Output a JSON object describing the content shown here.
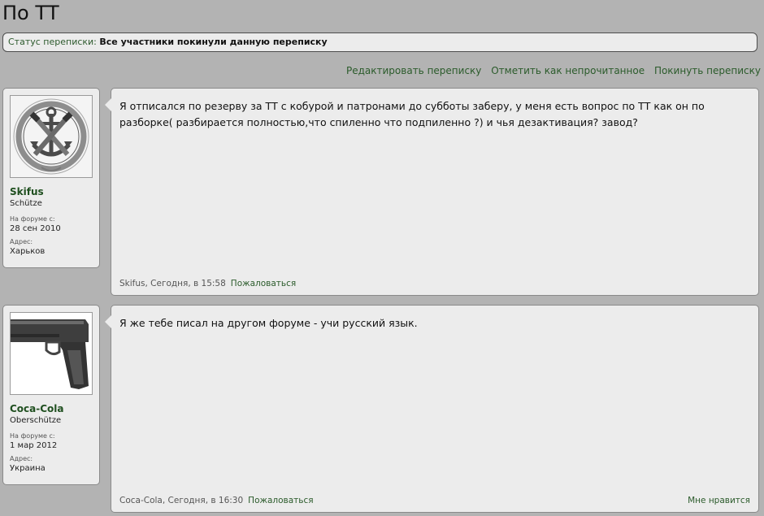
{
  "page": {
    "title": "По ТТ"
  },
  "status": {
    "label": "Статус переписки:",
    "value": "Все участники покинули данную переписку"
  },
  "actions": {
    "edit": "Редактировать переписку",
    "mark_unread": "Отметить как непрочитанное",
    "leave": "Покинуть переписку"
  },
  "messages": [
    {
      "user": {
        "name": "Skifus",
        "rank": "Schütze",
        "joined_label": "На форуме с:",
        "joined": "28 сен 2010",
        "address_label": "Адрес:",
        "address": "Харьков",
        "avatar_icon": "anchor-badge-icon",
        "avatar_text": "SEMPER · ERITIS"
      },
      "text": "Я отписался по резерву за ТТ с кобурой и патронами до субботы заберу, у меня есть вопрос по ТТ как он по разборке( разбирается полностью,что спиленно что подпиленно ?) и чья дезактивация? завод?",
      "meta": "Skifus, Сегодня, в 15:58",
      "report": "Пожаловаться"
    },
    {
      "user": {
        "name": "Coca-Cola",
        "rank": "Oberschütze",
        "joined_label": "На форуме с:",
        "joined": "1 мар 2012",
        "address_label": "Адрес:",
        "address": "Украина",
        "avatar_icon": "pistol-icon"
      },
      "text": "Я же тебе писал на другом форуме - учи русский язык.",
      "meta": "Coca-Cola, Сегодня, в 16:30",
      "report": "Пожаловаться",
      "like": "Мне нравится"
    }
  ],
  "colors": {
    "accent": "#2b5b2b",
    "page_bg": "#b3b3b3",
    "panel_bg": "#ececec"
  }
}
